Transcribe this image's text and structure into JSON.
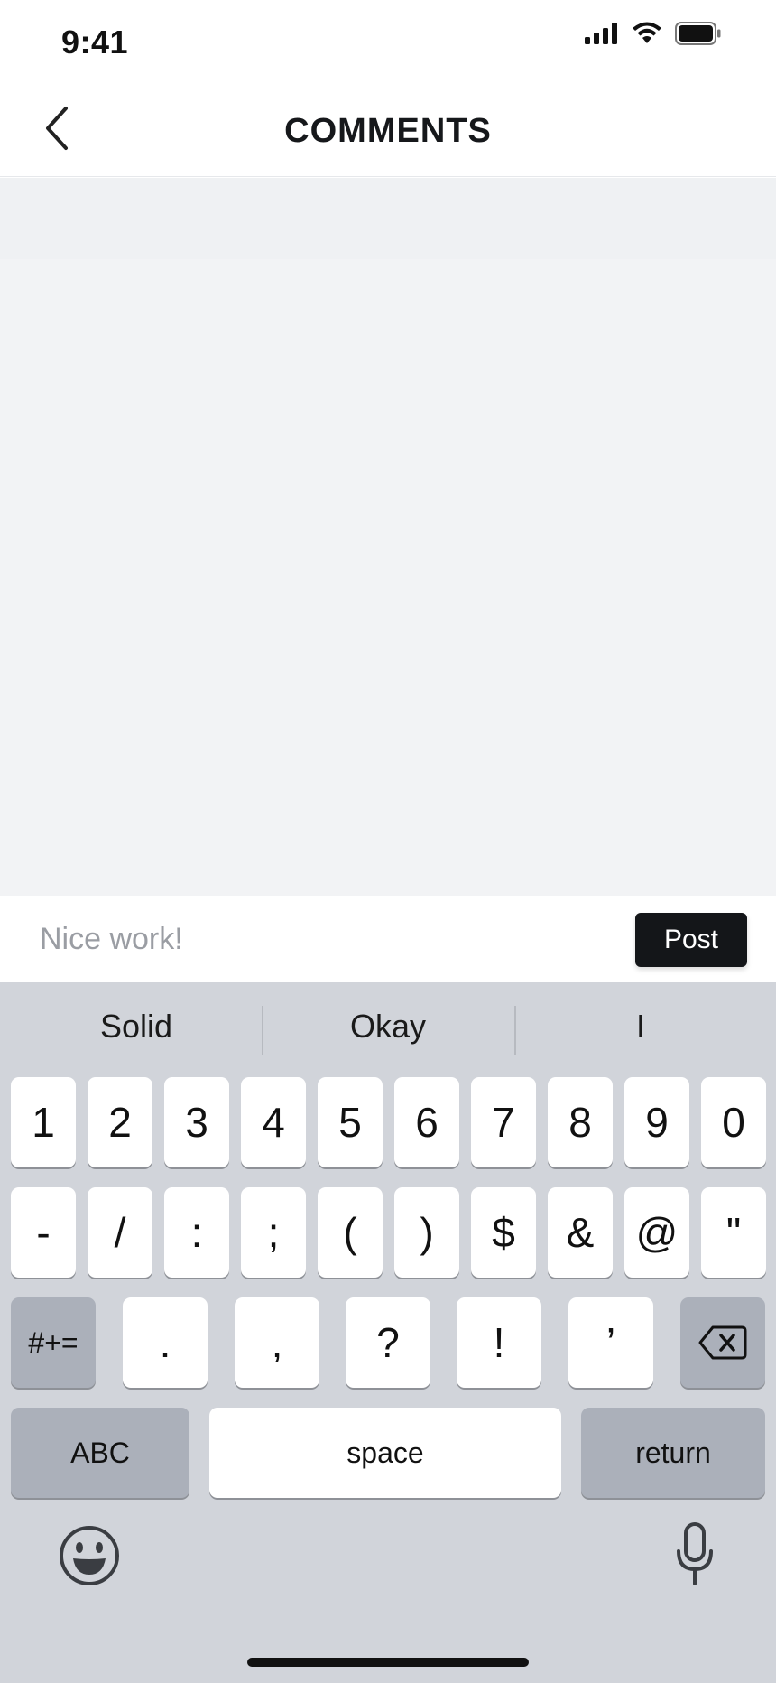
{
  "status_bar": {
    "time": "9:41"
  },
  "header": {
    "title": "COMMENTS"
  },
  "composer": {
    "placeholder": "Nice work!",
    "post_label": "Post"
  },
  "keyboard": {
    "suggestions": [
      "Solid",
      "Okay",
      "I"
    ],
    "row1": [
      "1",
      "2",
      "3",
      "4",
      "5",
      "6",
      "7",
      "8",
      "9",
      "0"
    ],
    "row2": [
      "-",
      "/",
      ":",
      ";",
      "(",
      ")",
      "$",
      "&",
      "@",
      "\""
    ],
    "row3": {
      "toggle": "#+=",
      "keys": [
        ".",
        ",",
        "?",
        "!",
        "’"
      ]
    },
    "row4": {
      "abc": "ABC",
      "space": "space",
      "return": "return"
    }
  },
  "colors": {
    "accent": "#141619",
    "keyboard_bg": "#d1d4da",
    "content_bg": "#f2f3f5"
  }
}
